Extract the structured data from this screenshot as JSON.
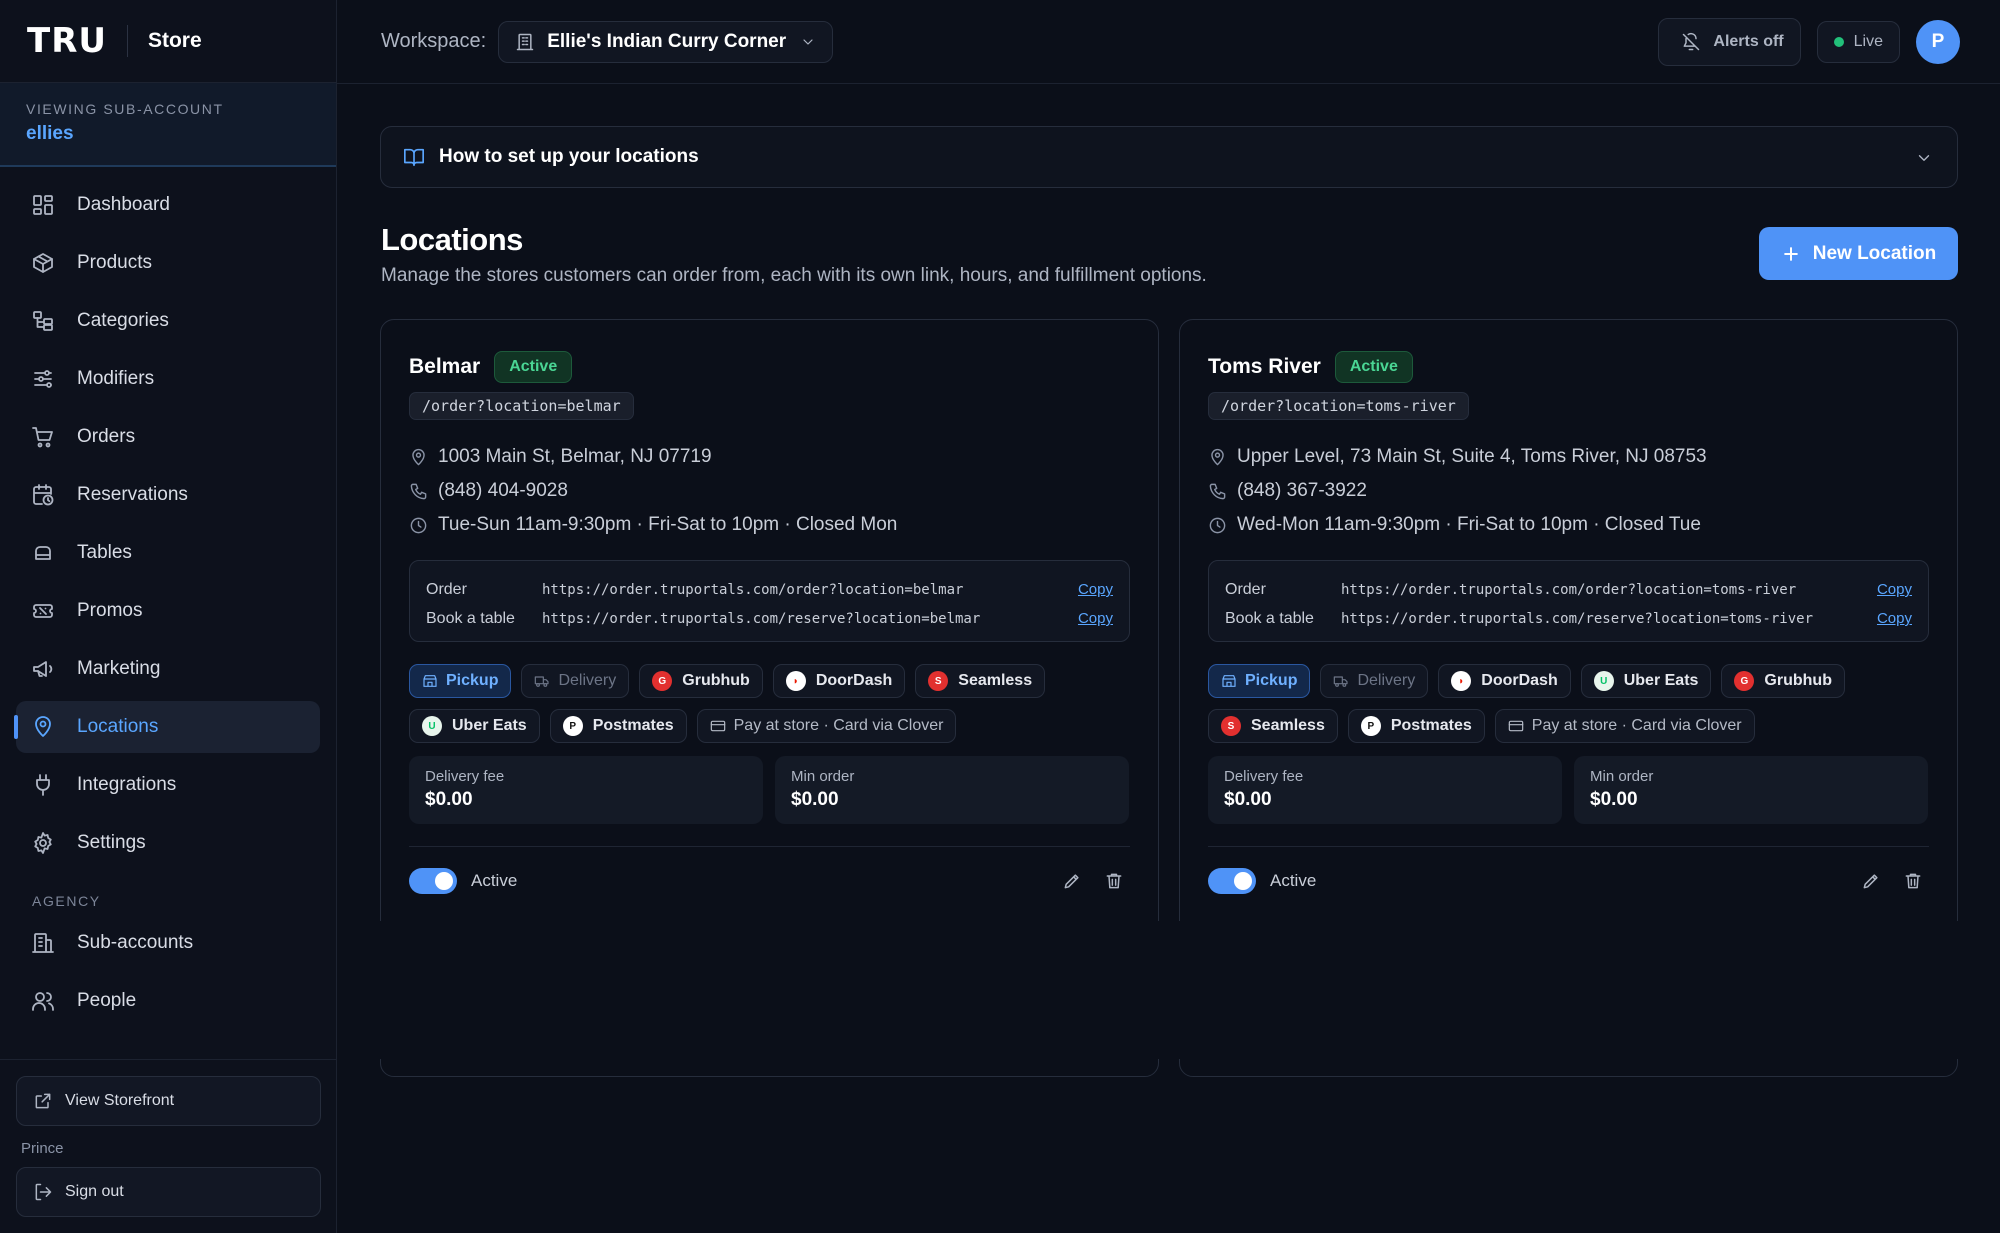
{
  "sidebar": {
    "logo": "TRU",
    "store": "Store",
    "viewing_label": "VIEWING SUB-ACCOUNT",
    "viewing_name": "ellies",
    "items": [
      {
        "label": "Dashboard",
        "icon": "dashboard-icon"
      },
      {
        "label": "Products",
        "icon": "box-icon"
      },
      {
        "label": "Categories",
        "icon": "categories-icon"
      },
      {
        "label": "Modifiers",
        "icon": "sliders-icon"
      },
      {
        "label": "Orders",
        "icon": "cart-icon"
      },
      {
        "label": "Reservations",
        "icon": "calendar-clock-icon"
      },
      {
        "label": "Tables",
        "icon": "table-icon"
      },
      {
        "label": "Promos",
        "icon": "ticket-icon"
      },
      {
        "label": "Marketing",
        "icon": "megaphone-icon"
      },
      {
        "label": "Locations",
        "icon": "map-pin-icon",
        "active": true
      },
      {
        "label": "Integrations",
        "icon": "plug-icon"
      },
      {
        "label": "Settings",
        "icon": "gear-icon"
      }
    ],
    "agency_label": "AGENCY",
    "agency_items": [
      {
        "label": "Sub-accounts",
        "icon": "building-icon"
      },
      {
        "label": "People",
        "icon": "users-icon"
      }
    ],
    "view_storefront": "View Storefront",
    "user": "Prince",
    "sign_out": "Sign out"
  },
  "topbar": {
    "workspace_label": "Workspace:",
    "workspace_name": "Ellie's Indian Curry Corner",
    "alerts": "Alerts off",
    "live": "Live",
    "avatar": "P"
  },
  "colors": {
    "accent": "#4f93f7",
    "active_green": "#4ad694",
    "background": "#0b0f19"
  },
  "howto": "How to set up your locations",
  "page": {
    "title": "Locations",
    "subtitle": "Manage the stores customers can order from, each with its own link, hours, and fulfillment options.",
    "new_button": "New Location"
  },
  "locations": [
    {
      "name": "Belmar",
      "status": "Active",
      "slug": "/order?location=belmar",
      "address": "1003 Main St, Belmar, NJ 07719",
      "phone": "(848) 404-9028",
      "hours": "Tue-Sun 11am-9:30pm · Fri-Sat to 10pm · Closed Mon",
      "order_label": "Order",
      "order_url": "https://order.truportals.com/order?location=belmar",
      "book_label": "Book a table",
      "book_url": "https://order.truportals.com/reserve?location=belmar",
      "copy": "Copy",
      "chips": [
        "Pickup",
        "Delivery",
        "Grubhub",
        "DoorDash",
        "Seamless",
        "Uber Eats",
        "Postmates",
        "Pay at store · Card via Clover"
      ],
      "delivery_fee_label": "Delivery fee",
      "delivery_fee": "$0.00",
      "min_order_label": "Min order",
      "min_order": "$0.00",
      "toggle_label": "Active"
    },
    {
      "name": "Toms River",
      "status": "Active",
      "slug": "/order?location=toms-river",
      "address": "Upper Level, 73 Main St, Suite 4, Toms River, NJ 08753",
      "phone": "(848) 367-3922",
      "hours": "Wed-Mon 11am-9:30pm · Fri-Sat to 10pm · Closed Tue",
      "order_label": "Order",
      "order_url": "https://order.truportals.com/order?location=toms-river",
      "book_label": "Book a table",
      "book_url": "https://order.truportals.com/reserve?location=toms-river",
      "copy": "Copy",
      "chips": [
        "Pickup",
        "Delivery",
        "DoorDash",
        "Uber Eats",
        "Grubhub",
        "Seamless",
        "Postmates",
        "Pay at store · Card via Clover"
      ],
      "delivery_fee_label": "Delivery fee",
      "delivery_fee": "$0.00",
      "min_order_label": "Min order",
      "min_order": "$0.00",
      "toggle_label": "Active"
    }
  ]
}
